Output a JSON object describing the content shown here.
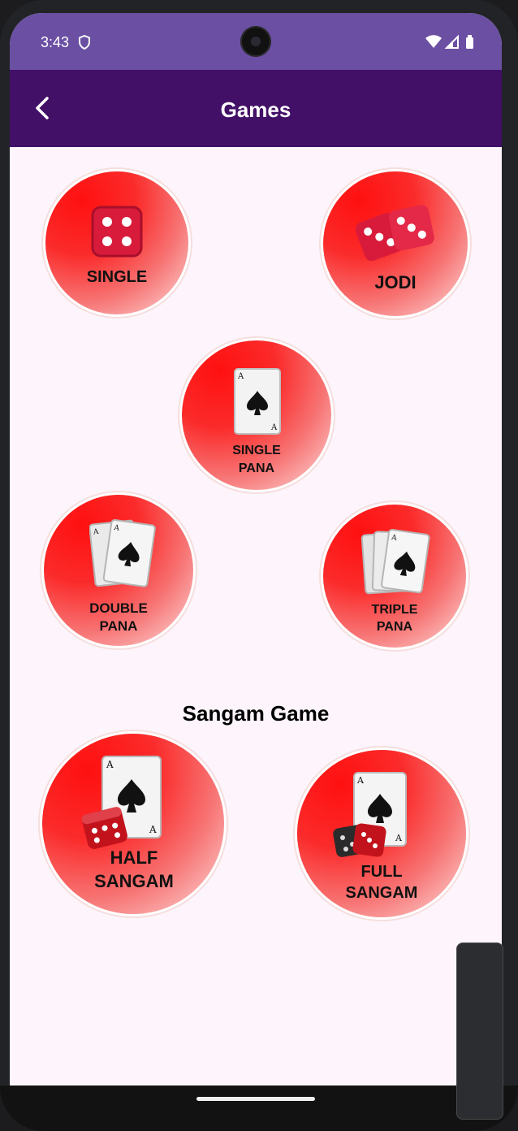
{
  "status_bar": {
    "time": "3:43"
  },
  "app_bar": {
    "title": "Games"
  },
  "games": [
    {
      "id": "single",
      "label_line1": "SINGLE",
      "label_line2": ""
    },
    {
      "id": "jodi",
      "label_line1": "JODI",
      "label_line2": ""
    },
    {
      "id": "single_pana",
      "label_line1": "SINGLE",
      "label_line2": "PANA"
    },
    {
      "id": "double_pana",
      "label_line1": "DOUBLE",
      "label_line2": "PANA"
    },
    {
      "id": "triple_pana",
      "label_line1": "TRIPLE",
      "label_line2": "PANA"
    }
  ],
  "sangam": {
    "section_title": "Sangam Game",
    "games": [
      {
        "id": "half_sangam",
        "label_line1": "HALF",
        "label_line2": "SANGAM"
      },
      {
        "id": "full_sangam",
        "label_line1": "FULL",
        "label_line2": "SANGAM"
      }
    ]
  },
  "icons": [
    "back-arrow-icon",
    "shield-icon",
    "wifi-icon",
    "signal-icon",
    "battery-icon",
    "dice-icon",
    "playing-card-icon"
  ],
  "colors": {
    "status_bar": "#6a4fa3",
    "app_bar": "#421066",
    "game_red": "#ff1010",
    "background": "#fdf5fb"
  }
}
